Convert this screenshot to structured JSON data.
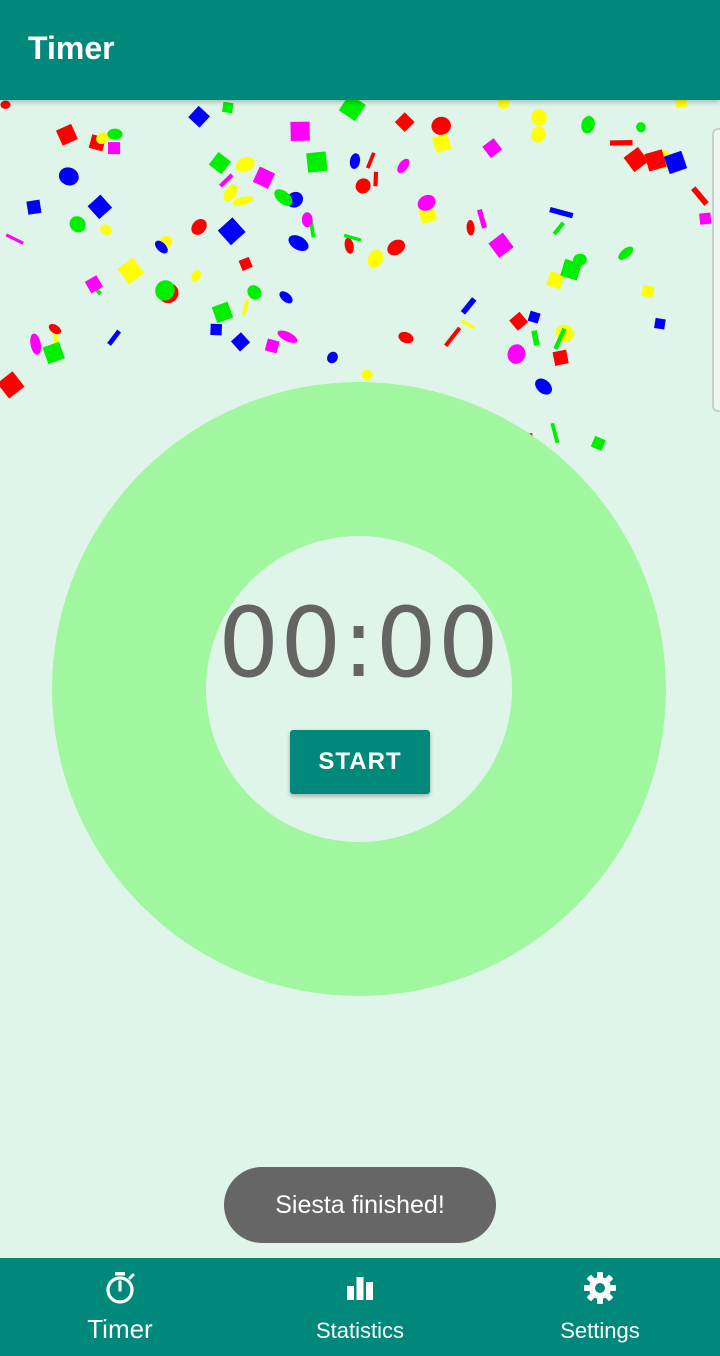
{
  "app_bar": {
    "title": "Timer"
  },
  "timer": {
    "time": "00:00",
    "start_label": "START",
    "ring_color": "#a0f7a0"
  },
  "toast": {
    "message": "Siesta finished!"
  },
  "bottom_nav": {
    "items": [
      {
        "label": "Timer",
        "icon": "stopwatch-icon",
        "active": true
      },
      {
        "label": "Statistics",
        "icon": "bar-chart-icon",
        "active": false
      },
      {
        "label": "Settings",
        "icon": "gear-icon",
        "active": false
      }
    ]
  },
  "colors": {
    "primary": "#00897b",
    "background": "#e0f5e9",
    "confetti": [
      "#ff0000",
      "#ffff00",
      "#00ee00",
      "#0000ff",
      "#ff00ff"
    ]
  }
}
